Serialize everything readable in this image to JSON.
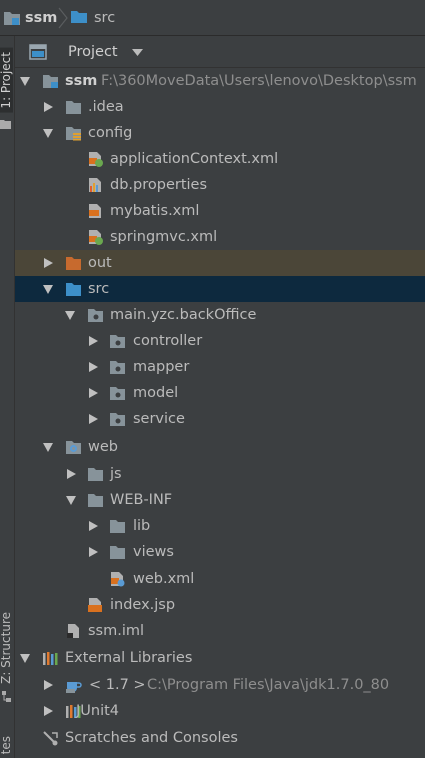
{
  "breadcrumb": {
    "project": "ssm",
    "folder": "src"
  },
  "side_tabs": {
    "project": "1: Project",
    "structure": "Z: Structure",
    "favorites": "tes"
  },
  "panel": {
    "view_mode": "Project"
  },
  "tree": {
    "root_name": "ssm",
    "root_path": "F:\\360MoveData\\Users\\lenovo\\Desktop\\ssm",
    "idea": ".idea",
    "config": "config",
    "app_context": "applicationContext.xml",
    "db_props": "db.properties",
    "mybatis": "mybatis.xml",
    "springmvc": "springmvc.xml",
    "out": "out",
    "src": "src",
    "package": "main.yzc.backOffice",
    "controller": "controller",
    "mapper": "mapper",
    "model": "model",
    "service": "service",
    "web": "web",
    "js": "js",
    "webinf": "WEB-INF",
    "lib": "lib",
    "views": "views",
    "webxml": "web.xml",
    "indexjsp": "index.jsp",
    "iml": "ssm.iml",
    "ext_libs": "External Libraries",
    "jdk_name": "< 1.7 >",
    "jdk_path": "C:\\Program Files\\Java\\jdk1.7.0_80",
    "junit": "JUnit4",
    "scratches": "Scratches and Consoles"
  },
  "colors": {
    "background": "#3c3f41",
    "selection_out": "#4b4638",
    "selection_src": "#0d293e",
    "folder": "#87939a",
    "source_folder": "#3d8fc8",
    "excluded_folder": "#c76a2e",
    "xml_orange": "#e07a30",
    "jsp_orange": "#d9711f"
  }
}
